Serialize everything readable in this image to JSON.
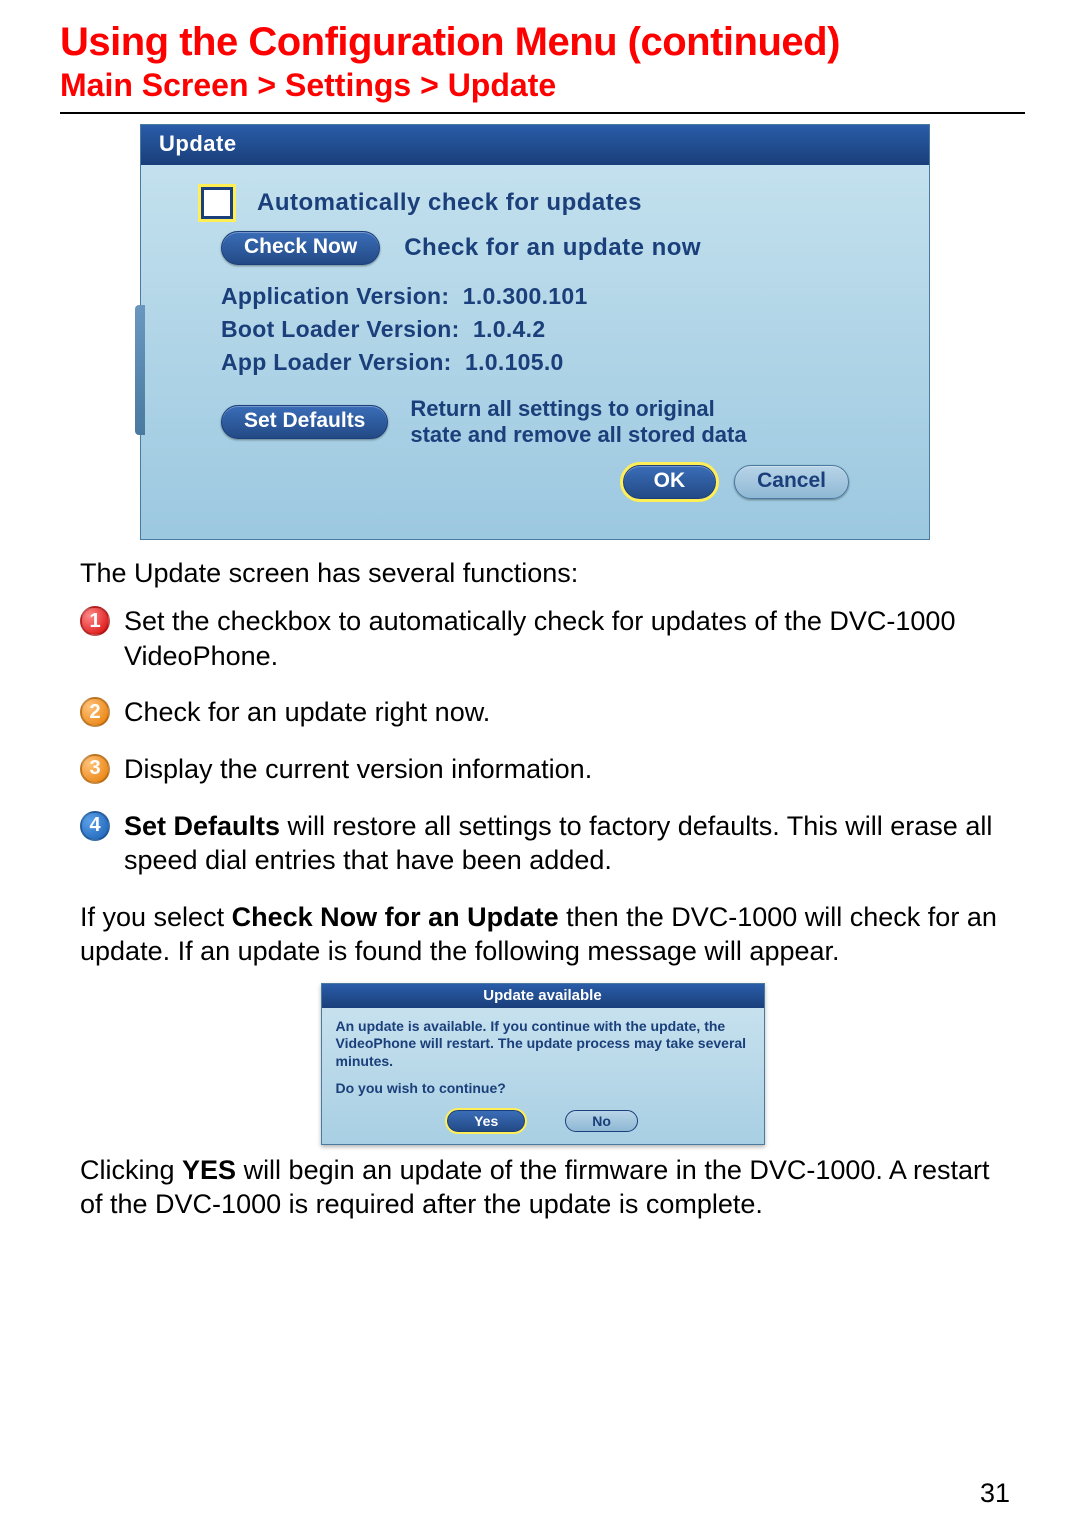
{
  "page_title": "Using the Configuration Menu (continued)",
  "breadcrumb": "Main Screen > Settings > Update",
  "update_window": {
    "title": "Update",
    "auto_check_label": "Automatically check for updates",
    "check_now_btn": "Check Now",
    "check_now_label": "Check for an update now",
    "app_version_label": "Application Version:",
    "app_version_value": "1.0.300.101",
    "boot_version_label": "Boot Loader Version:",
    "boot_version_value": "1.0.4.2",
    "apploader_version_label": "App Loader Version:",
    "apploader_version_value": "1.0.105.0",
    "set_defaults_btn": "Set Defaults",
    "set_defaults_text1": "Return all settings to original",
    "set_defaults_text2": "state and remove all stored data",
    "ok_btn": "OK",
    "cancel_btn": "Cancel"
  },
  "intro_text": "The Update screen has several functions:",
  "items": [
    {
      "num": "1",
      "text": "Set the checkbox to automatically check for updates of the DVC-1000 VideoPhone."
    },
    {
      "num": "2",
      "text": "Check for an update right now."
    },
    {
      "num": "3",
      "text": "Display the current version information."
    }
  ],
  "item4": {
    "num": "4",
    "bold": "Set Defaults",
    "rest": " will restore all settings to factory defaults. This will erase all speed dial entries that have been added."
  },
  "para2_pre": "If you select ",
  "para2_bold": "Check Now for an Update",
  "para2_post": " then the DVC-1000 will check for an update. If an update is found the following message will appear.",
  "dialog": {
    "title": "Update available",
    "body": "An update is available.  If you continue with the update, the VideoPhone will restart.  The update process may take several minutes.",
    "question": "Do you wish to continue?",
    "yes": "Yes",
    "no": "No"
  },
  "para3_pre": "Clicking ",
  "para3_bold": "YES",
  "para3_post": " will begin an update of the firmware in the DVC-1000.  A restart of the DVC-1000 is required after the update is complete.",
  "page_number": "31"
}
